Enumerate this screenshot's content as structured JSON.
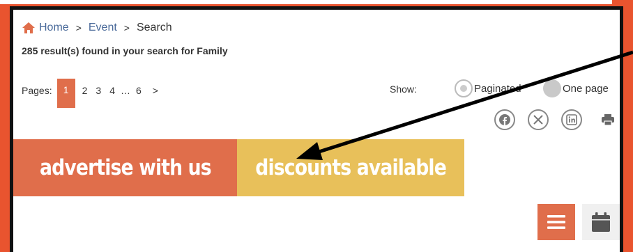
{
  "breadcrumb": {
    "home": "Home",
    "event": "Event",
    "current": "Search",
    "separator": ">"
  },
  "results_text": "285 result(s) found in your search for Family",
  "pagination": {
    "label": "Pages:",
    "pages": [
      "1",
      "2",
      "3",
      "4",
      "…",
      "6",
      ">"
    ],
    "active": "1"
  },
  "show": {
    "label": "Show:",
    "options": [
      "Paginated",
      "One page"
    ],
    "selected": "Paginated"
  },
  "social_icons": [
    "facebook-icon",
    "x-icon",
    "linkedin-icon",
    "print-icon"
  ],
  "banners": {
    "advertise": "advertise with us",
    "discounts": "discounts available"
  },
  "view_buttons": [
    "menu-icon",
    "calendar-icon"
  ],
  "colors": {
    "accent_orange": "#e06e4b",
    "accent_yellow": "#e8c05a",
    "link": "#4a6a9a",
    "background": "#e9542f"
  }
}
